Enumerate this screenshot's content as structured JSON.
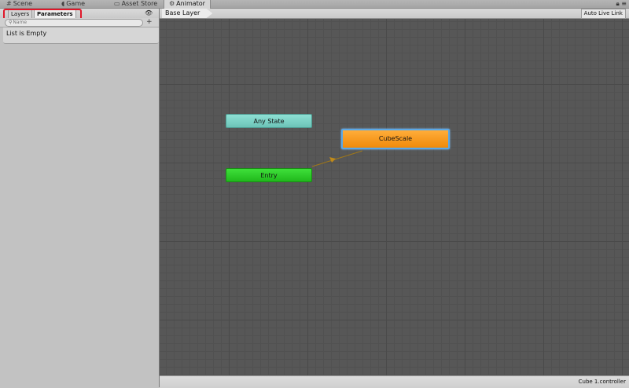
{
  "top_tabs": [
    {
      "label": "Scene",
      "icon": "grid-icon"
    },
    {
      "label": "Game",
      "icon": "pacman-icon"
    },
    {
      "label": "Asset Store",
      "icon": "store-icon"
    },
    {
      "label": "Animator",
      "icon": "animator-icon",
      "active": true
    }
  ],
  "left_panel": {
    "tabs": [
      {
        "label": "Layers",
        "active": false
      },
      {
        "label": "Parameters",
        "active": true
      }
    ],
    "search": {
      "placeholder": "Name",
      "icon": "search-icon"
    },
    "add_label": "+",
    "list_empty": "List is Empty"
  },
  "graph": {
    "breadcrumb": "Base Layer",
    "auto_live_link": "Auto Live Link",
    "states": {
      "any_state": "Any State",
      "entry": "Entry",
      "cube_scale": "CubeScale"
    }
  },
  "status_bar": {
    "file": "Cube 1.controller"
  },
  "colors": {
    "any_state": "#7fd4c8",
    "entry": "#2fcc2a",
    "cube_scale": "#f89a1c",
    "highlight": "#e0182a",
    "graph_bg": "#575757"
  }
}
